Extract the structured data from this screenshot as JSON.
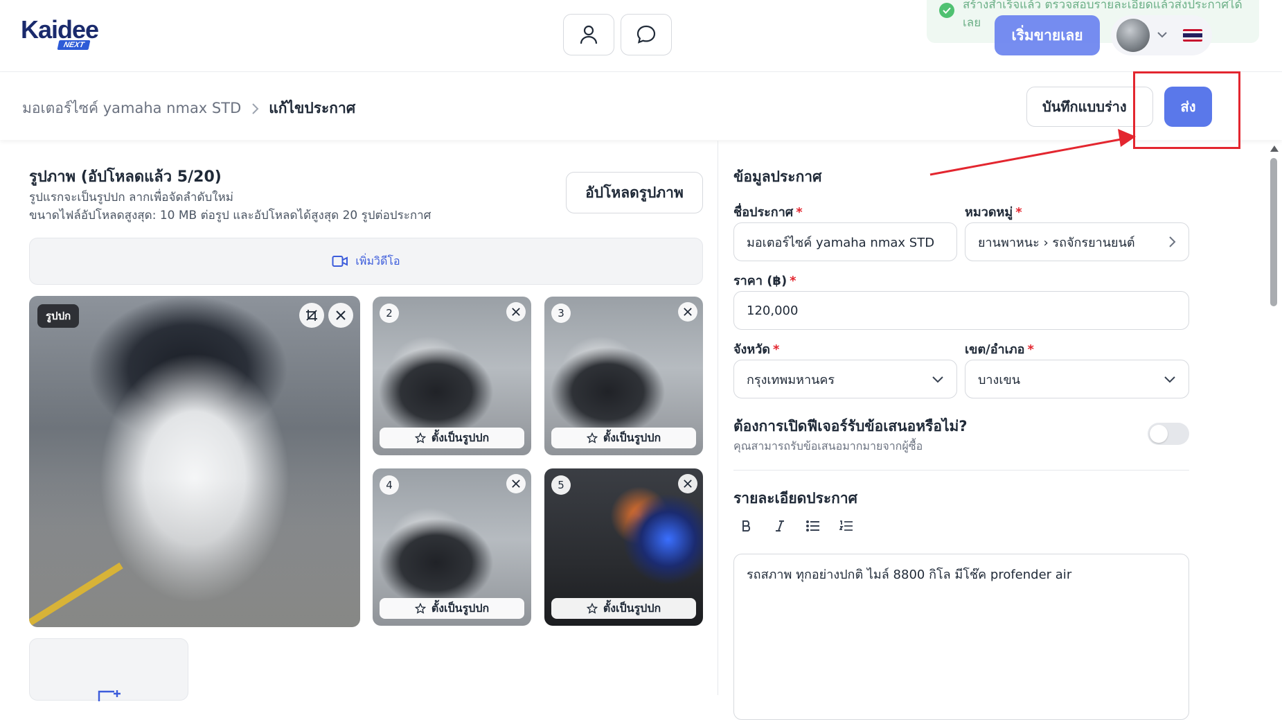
{
  "header": {
    "logo_text": "Kaidee",
    "logo_badge": "NEXT",
    "toast_text": "สร้างสำเร็จแล้ว ตรวจสอบรายละเอียดแล้วส่งประกาศได้เลย",
    "sell_button": "เริ่มขายเลย"
  },
  "breadcrumb": {
    "parent": "มอเตอร์ไซค์ yamaha nmax STD",
    "current": "แก้ไขประกาศ"
  },
  "actions": {
    "draft_button": "บันทึกแบบร่าง",
    "send_button": "ส่ง"
  },
  "photos": {
    "title": "รูปภาพ (อัปโหลดแล้ว 5/20)",
    "subtitle1": "รูปแรกจะเป็นรูปปก ลากเพื่อจัดลำดับใหม่",
    "subtitle2": "ขนาดไฟล์อัปโหลดสูงสุด: 10 MB ต่อรูป และอัปโหลดได้สูงสุด 20 รูปต่อประกาศ",
    "upload_button": "อัปโหลดรูปภาพ",
    "add_video": "เพิ่มวิดีโอ",
    "cover_badge": "รูปปก",
    "set_cover_label": "ตั้งเป็นรูปปก",
    "items": [
      {
        "number": "2"
      },
      {
        "number": "3"
      },
      {
        "number": "4"
      },
      {
        "number": "5"
      }
    ]
  },
  "listing": {
    "section_title": "ข้อมูลประกาศ",
    "name_label": "ชื่อประกาศ",
    "name_value": "มอเตอร์ไซค์ yamaha nmax STD",
    "category_label": "หมวดหมู่",
    "category_value": "ยานพาหนะ › รถจักรยานยนต์",
    "price_label": "ราคา (฿)",
    "price_value": "120,000",
    "province_label": "จังหวัด",
    "province_value": "กรุงเทพมหานคร",
    "district_label": "เขต/อำเภอ",
    "district_value": "บางเขน",
    "required_mark": "*",
    "offer_title": "ต้องการเปิดฟีเจอร์รับข้อเสนอหรือไม่?",
    "offer_subtitle": "คุณสามารถรับข้อเสนอมากมายจากผู้ซื้อ",
    "offer_enabled": false
  },
  "description": {
    "section_title": "รายละเอียดประกาศ",
    "text": "รถสภาพ ทุกอย่างปกติ ไมล์ 8800 กิโล มีโช๊ค profender air",
    "toolbar_icons": [
      "bold-icon",
      "italic-icon",
      "bullet-list-icon",
      "numbered-list-icon"
    ]
  },
  "colors": {
    "primary": "#5a78ea",
    "annotation_red": "#e3262f",
    "toast_green": "#3dbb62"
  }
}
